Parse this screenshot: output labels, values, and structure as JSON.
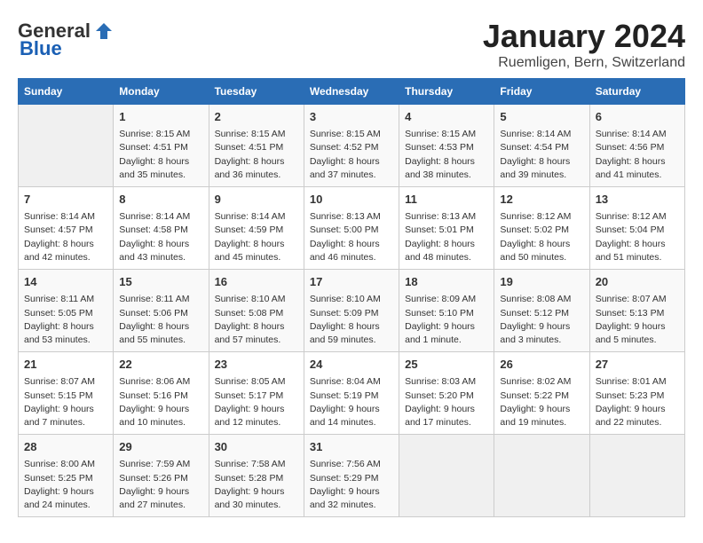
{
  "logo": {
    "general": "General",
    "blue": "Blue"
  },
  "title": "January 2024",
  "subtitle": "Ruemligen, Bern, Switzerland",
  "days_header": [
    "Sunday",
    "Monday",
    "Tuesday",
    "Wednesday",
    "Thursday",
    "Friday",
    "Saturday"
  ],
  "weeks": [
    [
      {
        "day": "",
        "content": ""
      },
      {
        "day": "1",
        "content": "Sunrise: 8:15 AM\nSunset: 4:51 PM\nDaylight: 8 hours\nand 35 minutes."
      },
      {
        "day": "2",
        "content": "Sunrise: 8:15 AM\nSunset: 4:51 PM\nDaylight: 8 hours\nand 36 minutes."
      },
      {
        "day": "3",
        "content": "Sunrise: 8:15 AM\nSunset: 4:52 PM\nDaylight: 8 hours\nand 37 minutes."
      },
      {
        "day": "4",
        "content": "Sunrise: 8:15 AM\nSunset: 4:53 PM\nDaylight: 8 hours\nand 38 minutes."
      },
      {
        "day": "5",
        "content": "Sunrise: 8:14 AM\nSunset: 4:54 PM\nDaylight: 8 hours\nand 39 minutes."
      },
      {
        "day": "6",
        "content": "Sunrise: 8:14 AM\nSunset: 4:56 PM\nDaylight: 8 hours\nand 41 minutes."
      }
    ],
    [
      {
        "day": "7",
        "content": "Sunrise: 8:14 AM\nSunset: 4:57 PM\nDaylight: 8 hours\nand 42 minutes."
      },
      {
        "day": "8",
        "content": "Sunrise: 8:14 AM\nSunset: 4:58 PM\nDaylight: 8 hours\nand 43 minutes."
      },
      {
        "day": "9",
        "content": "Sunrise: 8:14 AM\nSunset: 4:59 PM\nDaylight: 8 hours\nand 45 minutes."
      },
      {
        "day": "10",
        "content": "Sunrise: 8:13 AM\nSunset: 5:00 PM\nDaylight: 8 hours\nand 46 minutes."
      },
      {
        "day": "11",
        "content": "Sunrise: 8:13 AM\nSunset: 5:01 PM\nDaylight: 8 hours\nand 48 minutes."
      },
      {
        "day": "12",
        "content": "Sunrise: 8:12 AM\nSunset: 5:02 PM\nDaylight: 8 hours\nand 50 minutes."
      },
      {
        "day": "13",
        "content": "Sunrise: 8:12 AM\nSunset: 5:04 PM\nDaylight: 8 hours\nand 51 minutes."
      }
    ],
    [
      {
        "day": "14",
        "content": "Sunrise: 8:11 AM\nSunset: 5:05 PM\nDaylight: 8 hours\nand 53 minutes."
      },
      {
        "day": "15",
        "content": "Sunrise: 8:11 AM\nSunset: 5:06 PM\nDaylight: 8 hours\nand 55 minutes."
      },
      {
        "day": "16",
        "content": "Sunrise: 8:10 AM\nSunset: 5:08 PM\nDaylight: 8 hours\nand 57 minutes."
      },
      {
        "day": "17",
        "content": "Sunrise: 8:10 AM\nSunset: 5:09 PM\nDaylight: 8 hours\nand 59 minutes."
      },
      {
        "day": "18",
        "content": "Sunrise: 8:09 AM\nSunset: 5:10 PM\nDaylight: 9 hours\nand 1 minute."
      },
      {
        "day": "19",
        "content": "Sunrise: 8:08 AM\nSunset: 5:12 PM\nDaylight: 9 hours\nand 3 minutes."
      },
      {
        "day": "20",
        "content": "Sunrise: 8:07 AM\nSunset: 5:13 PM\nDaylight: 9 hours\nand 5 minutes."
      }
    ],
    [
      {
        "day": "21",
        "content": "Sunrise: 8:07 AM\nSunset: 5:15 PM\nDaylight: 9 hours\nand 7 minutes."
      },
      {
        "day": "22",
        "content": "Sunrise: 8:06 AM\nSunset: 5:16 PM\nDaylight: 9 hours\nand 10 minutes."
      },
      {
        "day": "23",
        "content": "Sunrise: 8:05 AM\nSunset: 5:17 PM\nDaylight: 9 hours\nand 12 minutes."
      },
      {
        "day": "24",
        "content": "Sunrise: 8:04 AM\nSunset: 5:19 PM\nDaylight: 9 hours\nand 14 minutes."
      },
      {
        "day": "25",
        "content": "Sunrise: 8:03 AM\nSunset: 5:20 PM\nDaylight: 9 hours\nand 17 minutes."
      },
      {
        "day": "26",
        "content": "Sunrise: 8:02 AM\nSunset: 5:22 PM\nDaylight: 9 hours\nand 19 minutes."
      },
      {
        "day": "27",
        "content": "Sunrise: 8:01 AM\nSunset: 5:23 PM\nDaylight: 9 hours\nand 22 minutes."
      }
    ],
    [
      {
        "day": "28",
        "content": "Sunrise: 8:00 AM\nSunset: 5:25 PM\nDaylight: 9 hours\nand 24 minutes."
      },
      {
        "day": "29",
        "content": "Sunrise: 7:59 AM\nSunset: 5:26 PM\nDaylight: 9 hours\nand 27 minutes."
      },
      {
        "day": "30",
        "content": "Sunrise: 7:58 AM\nSunset: 5:28 PM\nDaylight: 9 hours\nand 30 minutes."
      },
      {
        "day": "31",
        "content": "Sunrise: 7:56 AM\nSunset: 5:29 PM\nDaylight: 9 hours\nand 32 minutes."
      },
      {
        "day": "",
        "content": ""
      },
      {
        "day": "",
        "content": ""
      },
      {
        "day": "",
        "content": ""
      }
    ]
  ]
}
